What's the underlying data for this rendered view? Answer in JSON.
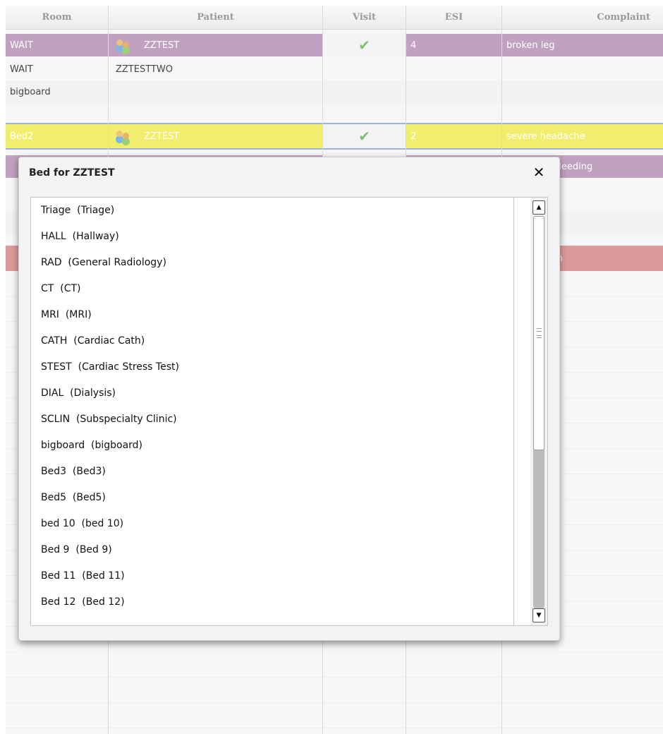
{
  "board": {
    "headers": {
      "room": "Room",
      "patient": "Patient",
      "visit": "Visit",
      "esi": "ESI",
      "complaint": "Complaint"
    },
    "rows": [
      {
        "room": "WAIT",
        "patient": "ZZTEST",
        "visit": "✔",
        "esi": "4",
        "complaint": "broken leg",
        "style": "purple"
      },
      {
        "room": "WAIT",
        "patient": "ZZTESTTWO",
        "visit": "",
        "esi": "",
        "complaint": "",
        "style": "plain"
      },
      {
        "room": "bigboard",
        "patient": "",
        "visit": "",
        "esi": "",
        "complaint": "",
        "style": "plain"
      },
      {
        "room": "Bed2",
        "patient": "ZZTEST",
        "visit": "✔",
        "esi": "2",
        "complaint": "severe headache",
        "style": "yellow"
      },
      {
        "room": "",
        "patient": "",
        "visit": "✔",
        "esi": "",
        "complaint": "bleeding",
        "style": "purple"
      },
      {
        "room": "",
        "patient": "",
        "visit": "",
        "esi": "",
        "complaint": "",
        "style": "plain"
      },
      {
        "room": "",
        "patient": "",
        "visit": "",
        "esi": "",
        "complaint": "",
        "style": "plain"
      },
      {
        "room": "",
        "patient": "",
        "visit": "",
        "esi": "",
        "complaint": "in",
        "style": "red"
      }
    ]
  },
  "modal": {
    "title": "Bed for ZZTEST",
    "close_glyph": "✕",
    "items": [
      "Triage  (Triage)",
      "HALL  (Hallway)",
      "RAD  (General Radiology)",
      "CT  (CT)",
      "MRI  (MRI)",
      "CATH  (Cardiac Cath)",
      "STEST  (Cardiac Stress Test)",
      "DIAL  (Dialysis)",
      "SCLIN  (Subspecialty Clinic)",
      "bigboard  (bigboard)",
      "Bed3  (Bed3)",
      "Bed5  (Bed5)",
      "bed 10  (bed 10)",
      "Bed 9  (Bed 9)",
      "Bed 11  (Bed 11)",
      "Bed 12  (Bed 12)"
    ],
    "scroll_up_glyph": "▲",
    "scroll_down_glyph": "▼"
  }
}
